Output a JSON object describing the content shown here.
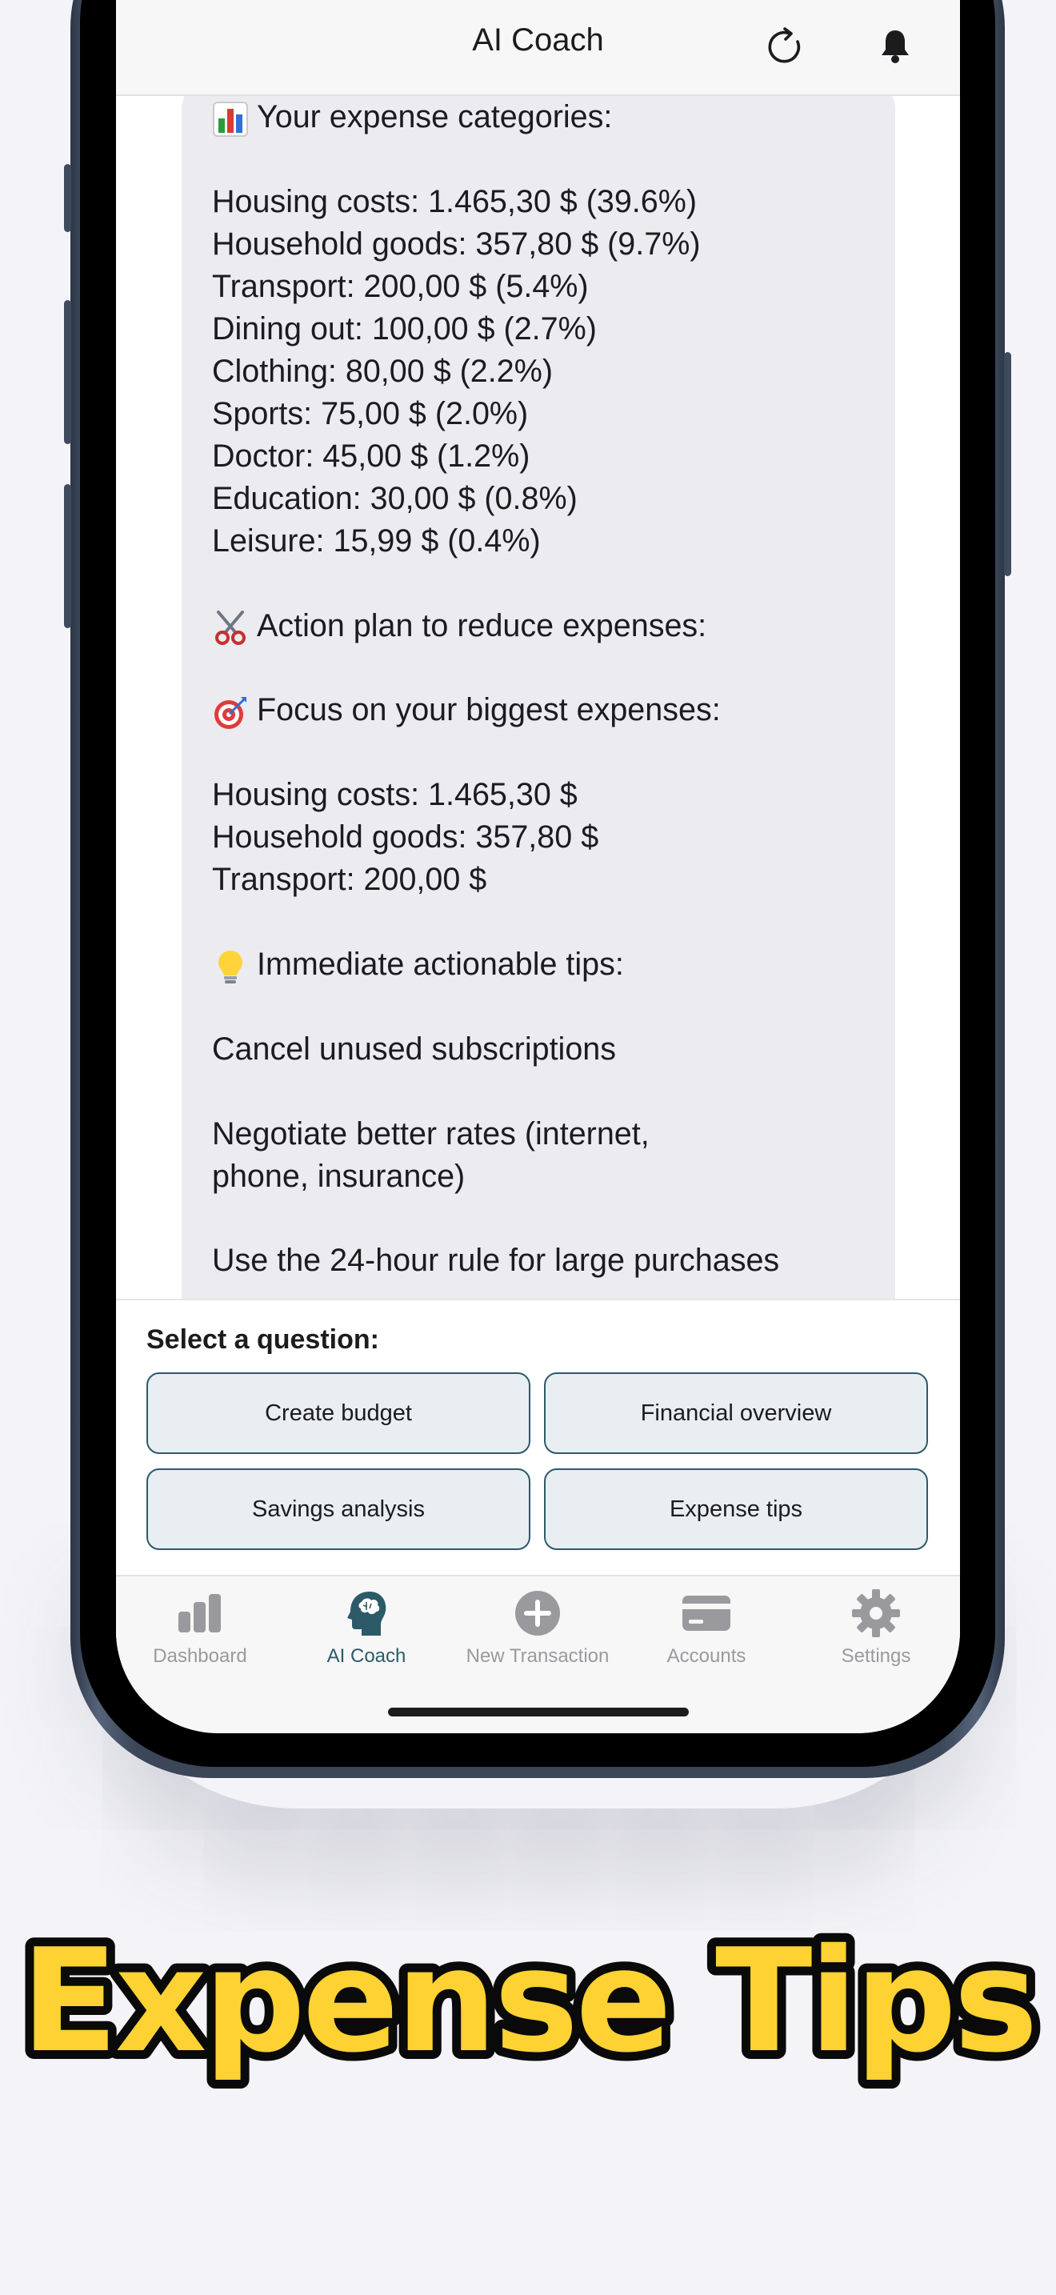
{
  "header": {
    "title": "AI Coach",
    "refresh_icon": "refresh-icon",
    "bell_icon": "bell-icon"
  },
  "chat": {
    "lines": [
      {
        "emoji": "bar-chart-emoji",
        "text": "Your expense categories:"
      },
      {
        "text": ""
      },
      {
        "text": "Housing costs: 1.465,30 $ (39.6%)"
      },
      {
        "text": "Household goods: 357,80 $ (9.7%)"
      },
      {
        "text": "Transport: 200,00 $ (5.4%)"
      },
      {
        "text": "Dining out: 100,00 $ (2.7%)"
      },
      {
        "text": "Clothing: 80,00 $ (2.2%)"
      },
      {
        "text": "Sports: 75,00 $ (2.0%)"
      },
      {
        "text": "Doctor: 45,00 $ (1.2%)"
      },
      {
        "text": "Education: 30,00 $ (0.8%)"
      },
      {
        "text": "Leisure: 15,99 $ (0.4%)"
      },
      {
        "text": ""
      },
      {
        "emoji": "scissors-emoji",
        "text": "Action plan to reduce expenses:"
      },
      {
        "text": ""
      },
      {
        "emoji": "target-emoji",
        "text": "Focus on your biggest expenses:"
      },
      {
        "text": ""
      },
      {
        "text": "Housing costs: 1.465,30 $"
      },
      {
        "text": "Household goods: 357,80 $"
      },
      {
        "text": "Transport: 200,00 $"
      },
      {
        "text": ""
      },
      {
        "emoji": "light-bulb-emoji",
        "text": "Immediate actionable tips:"
      },
      {
        "text": ""
      },
      {
        "text": "Cancel unused subscriptions"
      },
      {
        "text": ""
      },
      {
        "text": "Negotiate better rates (internet,"
      },
      {
        "text": "phone, insurance)"
      },
      {
        "text": ""
      },
      {
        "text": "Use the 24-hour rule for large purchases"
      }
    ]
  },
  "questions": {
    "heading": "Select a question:",
    "options": [
      "Create budget",
      "Financial overview",
      "Savings analysis",
      "Expense tips"
    ]
  },
  "tabbar": {
    "tabs": [
      {
        "label": "Dashboard",
        "icon": "bar-chart-icon",
        "active": false
      },
      {
        "label": "AI Coach",
        "icon": "brain-head-icon",
        "active": true
      },
      {
        "label": "New Transaction",
        "icon": "plus-circle-icon",
        "active": false
      },
      {
        "label": "Accounts",
        "icon": "credit-card-icon",
        "active": false
      },
      {
        "label": "Settings",
        "icon": "gear-icon",
        "active": false
      }
    ]
  },
  "promo": {
    "title": "Expense Tips"
  },
  "colors": {
    "accent": "#2c5a68",
    "promo_fill": "#fdd232",
    "promo_stroke": "#0a0a0a",
    "bubble": "#ebebf0"
  }
}
